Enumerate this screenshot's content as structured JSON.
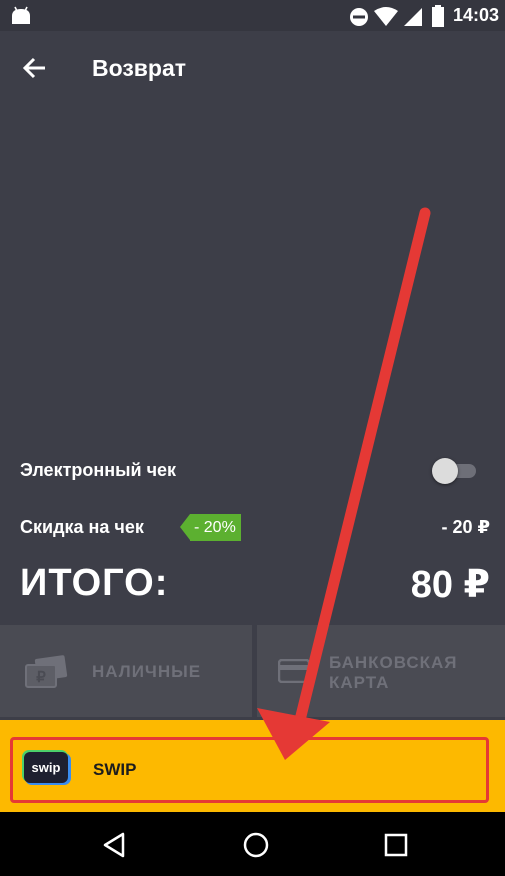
{
  "status_bar": {
    "time": "14:03",
    "icons": [
      "android-icon",
      "do-not-disturb-icon",
      "wifi-icon",
      "signal-icon",
      "battery-icon"
    ]
  },
  "toolbar": {
    "back_icon": "arrow-back-icon",
    "title": "Возврат"
  },
  "receipt": {
    "electronic_label": "Электронный чек",
    "electronic_enabled": false,
    "discount_label": "Скидка на чек",
    "discount_badge": "- 20%",
    "discount_amount": "- 20 ₽",
    "total_label": "ИТОГО:",
    "total_amount": "80 ₽"
  },
  "payment": {
    "cash_label": "НАЛИЧНЫЕ",
    "cash_icon": "cash-icon",
    "card_label_line1": "БАНКОВСКАЯ",
    "card_label_line2": "КАРТА",
    "card_icon": "credit-card-icon",
    "swip_label": "SWIP",
    "swip_logo_text": "swip"
  },
  "nav_bar": {
    "icons": [
      "nav-back-icon",
      "nav-home-icon",
      "nav-recents-icon"
    ]
  },
  "colors": {
    "background": "#3d3e48",
    "accent_yellow": "#fdb900",
    "discount_green": "#5cb030",
    "highlight_red": "#e53935"
  }
}
